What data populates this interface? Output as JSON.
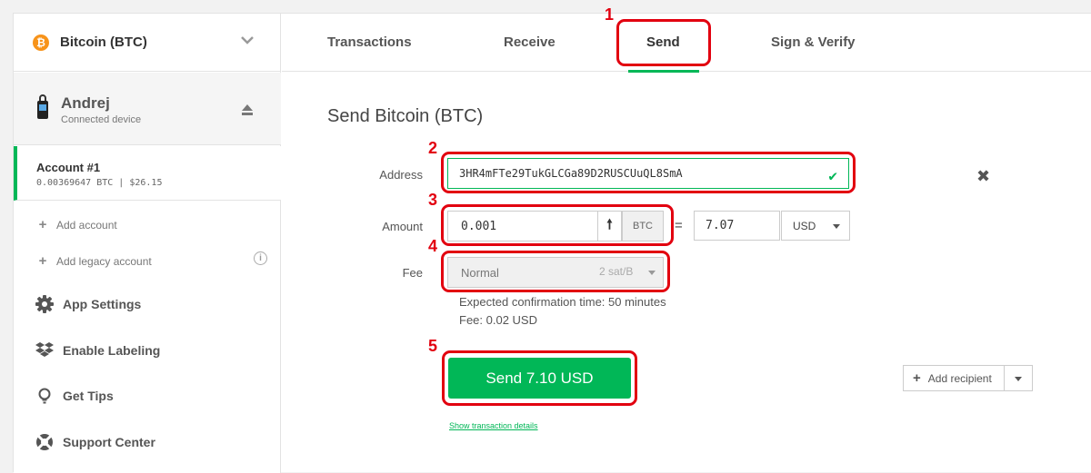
{
  "sidebar": {
    "coin": {
      "name": "Bitcoin (BTC)",
      "symbol": "₿"
    },
    "device": {
      "name": "Andrej",
      "status": "Connected device"
    },
    "account": {
      "title": "Account #1",
      "balance": "0.00369647 BTC | $26.15"
    },
    "links": {
      "add_account": "Add account",
      "add_legacy": "Add legacy account"
    },
    "menu": {
      "app_settings": "App Settings",
      "enable_labeling": "Enable Labeling",
      "get_tips": "Get Tips",
      "support_center": "Support Center"
    }
  },
  "tabs": {
    "transactions": "Transactions",
    "receive": "Receive",
    "send": "Send",
    "sign_verify": "Sign & Verify",
    "active": "Send"
  },
  "annotations": [
    "1",
    "2",
    "3",
    "4",
    "5"
  ],
  "form": {
    "title": "Send Bitcoin (BTC)",
    "address_label": "Address",
    "address_value": "3HR4mFTe29TukGLCGa89D2RUSCUuQL8SmA",
    "amount_label": "Amount",
    "amount_value": "0.001",
    "amount_unit": "BTC",
    "equals": "=",
    "fiat_value": "7.07",
    "fiat_currency": "USD",
    "fee_label": "Fee",
    "fee_level": "Normal",
    "fee_rate": "2 sat/B",
    "confirmation_time": "Expected confirmation time: 50 minutes",
    "fee_amount": "Fee: 0.02 USD",
    "send_button": "Send 7.10 USD",
    "details_link": "Show transaction details",
    "add_recipient": "Add recipient"
  },
  "colors": {
    "accent": "#01b757",
    "annotation": "#e2000f",
    "bitcoin": "#f7931a"
  }
}
